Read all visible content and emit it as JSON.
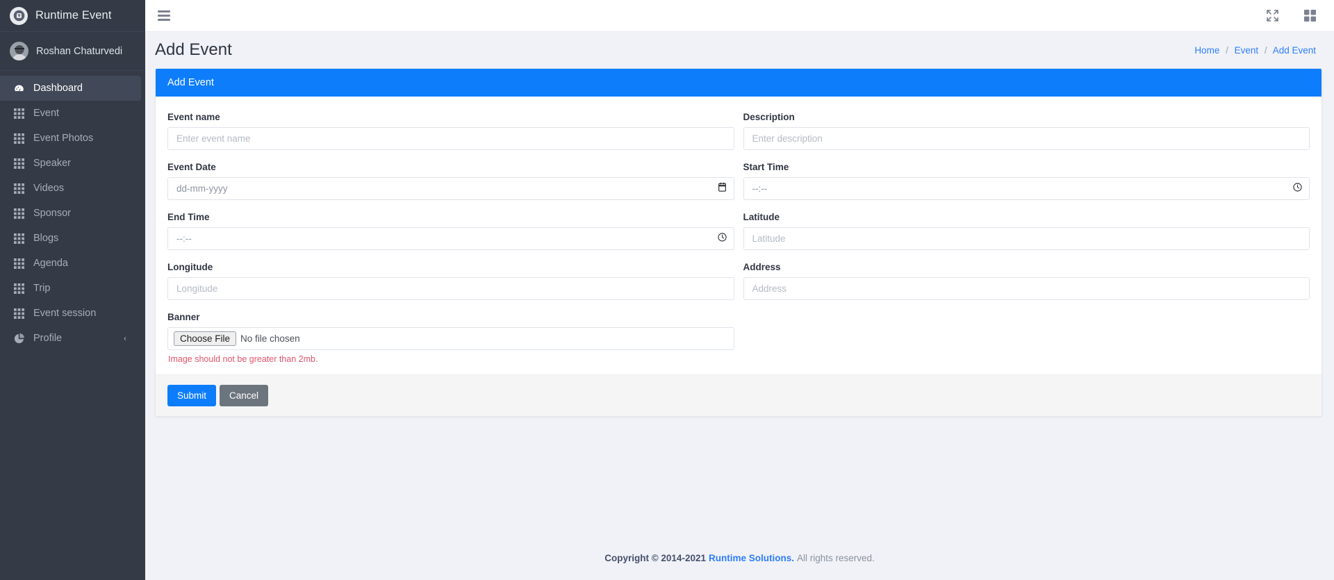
{
  "brand": {
    "title": "Runtime Event",
    "logo_icon": "runtime-logo-icon"
  },
  "sidebar": {
    "user": {
      "name": "Roshan Chaturvedi",
      "avatar_icon": "user-avatar"
    },
    "items": [
      {
        "label": "Dashboard",
        "icon": "dashboard-icon",
        "active": true
      },
      {
        "label": "Event",
        "icon": "grid-icon",
        "active": false
      },
      {
        "label": "Event Photos",
        "icon": "grid-icon",
        "active": false
      },
      {
        "label": "Speaker",
        "icon": "grid-icon",
        "active": false
      },
      {
        "label": "Videos",
        "icon": "grid-icon",
        "active": false
      },
      {
        "label": "Sponsor",
        "icon": "grid-icon",
        "active": false
      },
      {
        "label": "Blogs",
        "icon": "grid-icon",
        "active": false
      },
      {
        "label": "Agenda",
        "icon": "grid-icon",
        "active": false
      },
      {
        "label": "Trip",
        "icon": "grid-icon",
        "active": false
      },
      {
        "label": "Event session",
        "icon": "grid-icon",
        "active": false
      },
      {
        "label": "Profile",
        "icon": "pie-chart-icon",
        "active": false,
        "chevron": "‹"
      }
    ]
  },
  "topbar": {
    "menu_icon": "hamburger-icon",
    "fullscreen_icon": "expand-arrows-icon",
    "apps_icon": "grid-apps-icon"
  },
  "page": {
    "title": "Add Event",
    "breadcrumb": [
      {
        "label": "Home"
      },
      {
        "label": "Event"
      },
      {
        "label": "Add Event"
      }
    ],
    "breadcrumb_separator": "/"
  },
  "card": {
    "header": "Add Event",
    "fields": {
      "event_name": {
        "label": "Event name",
        "placeholder": "Enter event name",
        "value": ""
      },
      "description": {
        "label": "Description",
        "placeholder": "Enter description",
        "value": ""
      },
      "event_date": {
        "label": "Event Date",
        "placeholder": "dd-mm-yyyy",
        "value": "",
        "icon": "calendar-icon"
      },
      "start_time": {
        "label": "Start Time",
        "placeholder": "--:--",
        "value": "",
        "icon": "clock-icon"
      },
      "end_time": {
        "label": "End Time",
        "placeholder": "--:--",
        "value": "",
        "icon": "clock-icon"
      },
      "latitude": {
        "label": "Latitude",
        "placeholder": "Latitude",
        "value": ""
      },
      "longitude": {
        "label": "Longitude",
        "placeholder": "Longitude",
        "value": ""
      },
      "address": {
        "label": "Address",
        "placeholder": "Address",
        "value": ""
      },
      "banner": {
        "label": "Banner",
        "button": "Choose File",
        "status": "No file chosen",
        "help": "Image should not be greater than 2mb."
      }
    },
    "actions": {
      "submit": "Submit",
      "cancel": "Cancel"
    }
  },
  "footer": {
    "copyright": "Copyright © 2014-2021",
    "company": "Runtime Solutions.",
    "rights": "All rights reserved."
  },
  "colors": {
    "accent": "#0d7dfc",
    "sidebar_bg": "#343a46",
    "sidebar_active": "#414857",
    "error": "#e3556b",
    "page_bg": "#f0f2f7"
  }
}
